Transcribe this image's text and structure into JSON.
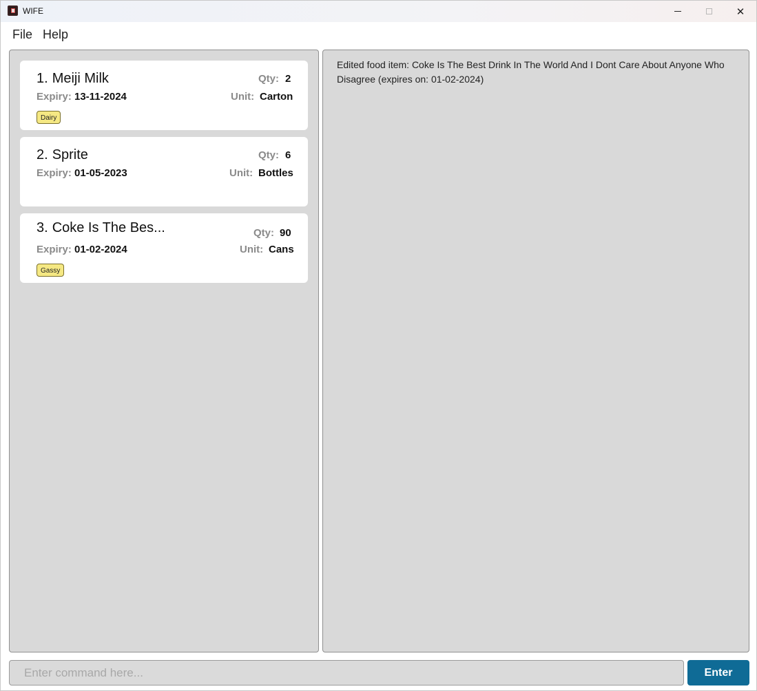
{
  "window": {
    "title": "WIFE",
    "controls": {
      "minimize_icon": "minimize-icon",
      "maximize_icon": "maximize-icon",
      "close_glyph": "✕"
    }
  },
  "menu": {
    "file_label": "File",
    "help_label": "Help"
  },
  "food_items": [
    {
      "index": "1.",
      "name": "Meiji Milk",
      "qty_label": "Qty:",
      "qty": "2",
      "expiry_label": "Expiry:",
      "expiry": "13-11-2024",
      "unit_label": "Unit:",
      "unit": "Carton",
      "tag": "Dairy"
    },
    {
      "index": "2.",
      "name": "Sprite",
      "qty_label": "Qty:",
      "qty": "6",
      "expiry_label": "Expiry:",
      "expiry": "01-05-2023",
      "unit_label": "Unit:",
      "unit": "Bottles",
      "tag": ""
    },
    {
      "index": "3.",
      "name": "Coke Is The Bes...",
      "qty_label": "Qty:",
      "qty": "90",
      "expiry_label": "Expiry:",
      "expiry": "01-02-2024",
      "unit_label": "Unit:",
      "unit": "Cans",
      "tag": "Gassy"
    }
  ],
  "result": {
    "message": "Edited food item: Coke Is The Best Drink In The World And I Dont Care About Anyone Who Disagree (expires on: 01-02-2024)"
  },
  "command": {
    "placeholder": "Enter command here...",
    "value": "",
    "enter_label": "Enter"
  },
  "colors": {
    "accent": "#0f6b96",
    "tag_background": "#f5e883",
    "panel_background": "#d9d9d9"
  }
}
